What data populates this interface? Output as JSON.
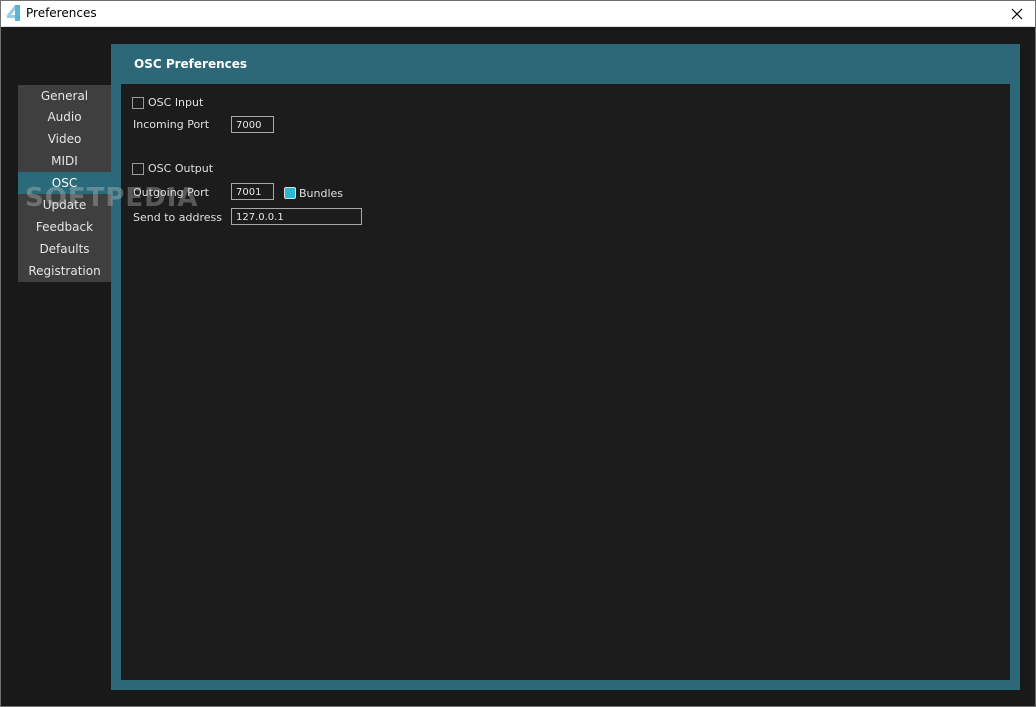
{
  "window": {
    "title": "Preferences",
    "accent_color": "#2c6878"
  },
  "sidebar": {
    "items": [
      {
        "label": "General"
      },
      {
        "label": "Audio"
      },
      {
        "label": "Video"
      },
      {
        "label": "MIDI"
      },
      {
        "label": "OSC",
        "active": true
      },
      {
        "label": "Update"
      },
      {
        "label": "Feedback"
      },
      {
        "label": "Defaults"
      },
      {
        "label": "Registration"
      }
    ]
  },
  "panel": {
    "title": "OSC Preferences",
    "osc_input": {
      "checkbox_label": "OSC Input",
      "checked": false,
      "port_label": "Incoming Port",
      "port_value": "7000"
    },
    "osc_output": {
      "checkbox_label": "OSC Output",
      "checked": false,
      "port_label": "Outgoing Port",
      "port_value": "7001",
      "bundles_label": "Bundles",
      "bundles_checked": true,
      "address_label": "Send to address",
      "address_value": "127.0.0.1"
    }
  },
  "watermark": "SOFTPEDIA"
}
